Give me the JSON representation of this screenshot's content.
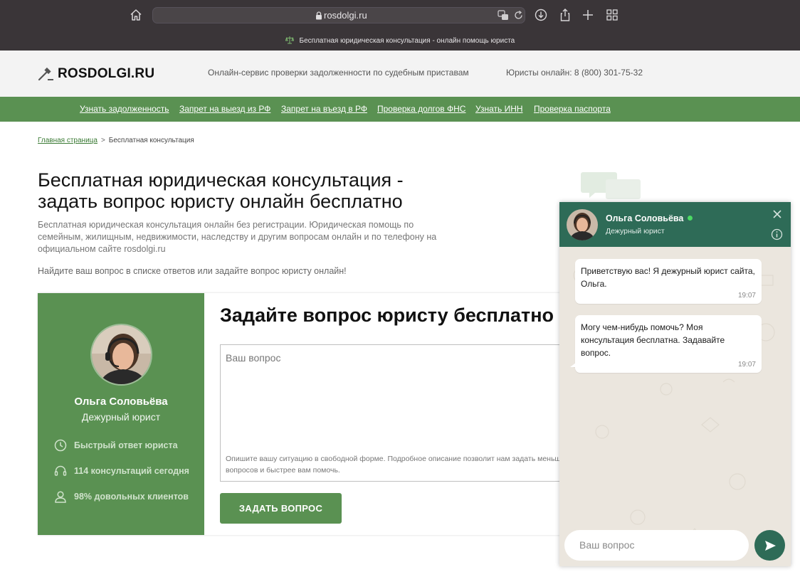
{
  "browser": {
    "url": "rosdolgi.ru",
    "tab_title": "Бесплатная юридическая консультация - онлайн помощь юриста"
  },
  "header": {
    "logo": "ROSDOLGI.RU",
    "tagline": "Онлайн-сервис проверки задолженности по судебным приставам",
    "phone": "Юристы онлайн: 8 (800) 301-75-32"
  },
  "nav": {
    "items": [
      "Узнать задолженность",
      "Запрет на выезд из РФ",
      "Запрет на въезд в РФ",
      "Проверка долгов ФНС",
      "Узнать ИНН",
      "Проверка паспорта"
    ]
  },
  "breadcrumb": {
    "home": "Главная страница",
    "separator": ">",
    "current": "Бесплатная консультация"
  },
  "main": {
    "title": "Бесплатная юридическая консультация - задать вопрос юристу онлайн бесплатно",
    "intro": "Бесплатная юридическая консультация онлайн без регистрации. Юридическая помощь по семейным, жилищным, недвижимости, наследству и другим вопросам онлайн и по телефону на официальном сайте rosdolgi.ru",
    "hint": "Найдите ваш вопрос в списке ответов или задайте вопрос юристу онлайн!"
  },
  "card": {
    "lawyer_name": "Ольга Соловьёва",
    "lawyer_role": "Дежурный юрист",
    "features": [
      "Быстрый ответ юриста",
      "114 консультаций сегодня",
      "98% довольных клиентов"
    ],
    "form_title": "Задайте вопрос юристу бесплатно",
    "question_placeholder": "Ваш вопрос",
    "question_description": "Опишите вашу ситуацию в свободной форме. Подробное описание позволит нам задать меньше вопросов и быстрее вам помочь.",
    "submit_label": "ЗАДАТЬ ВОПРОС"
  },
  "chat": {
    "name": "Ольга Соловьёва",
    "role": "Дежурный юрист",
    "status_color": "#4cd964",
    "messages": [
      {
        "text": "Приветствую вас! Я дежурный юрист сайта, Ольга.",
        "time": "19:07"
      },
      {
        "text": "Могу чем-нибудь помочь? Моя консультация бесплатна. Задавайте вопрос.",
        "time": "19:07"
      }
    ],
    "input_placeholder": "Ваш вопрос"
  },
  "colors": {
    "brand_green": "#5a9152",
    "chat_header": "#2e6b57",
    "chrome_bg": "#3a3538"
  }
}
